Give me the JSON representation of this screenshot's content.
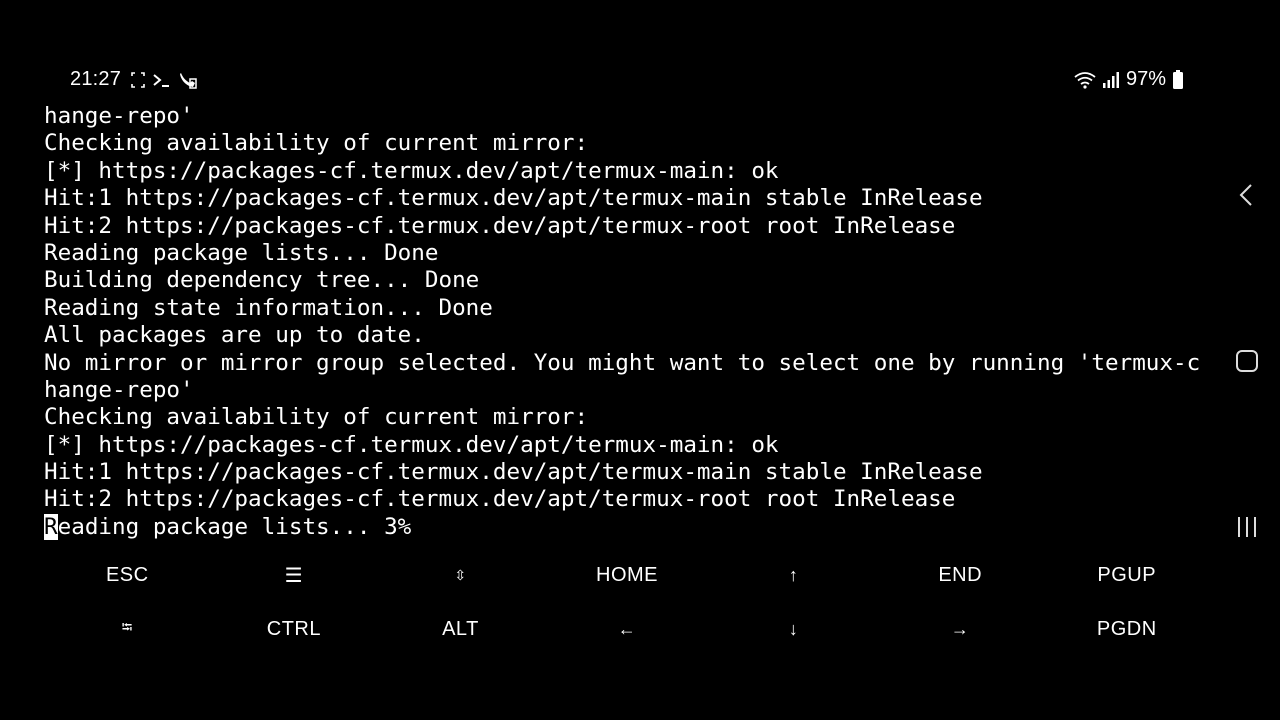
{
  "status_bar": {
    "time": "21:27",
    "battery": "97%",
    "notif_icons": [
      "screenshot-icon",
      "terminal-icon",
      "wifi-calling-icon"
    ],
    "system_icons": [
      "wifi-icon",
      "signal-icon",
      "battery-icon"
    ]
  },
  "terminal": {
    "lines": [
      "hange-repo'",
      "Checking availability of current mirror:",
      "[*] https://packages-cf.termux.dev/apt/termux-main: ok",
      "Hit:1 https://packages-cf.termux.dev/apt/termux-main stable InRelease",
      "Hit:2 https://packages-cf.termux.dev/apt/termux-root root InRelease",
      "Reading package lists... Done",
      "Building dependency tree... Done",
      "Reading state information... Done",
      "All packages are up to date.",
      "No mirror or mirror group selected. You might want to select one by running 'termux-c",
      "hange-repo'",
      "Checking availability of current mirror:",
      "[*] https://packages-cf.termux.dev/apt/termux-main: ok",
      "Hit:1 https://packages-cf.termux.dev/apt/termux-main stable InRelease",
      "Hit:2 https://packages-cf.termux.dev/apt/termux-root root InRelease"
    ],
    "cursor_char": "R",
    "last_line_rest": "eading package lists... 3%"
  },
  "extra_keys": {
    "row1": [
      "ESC",
      "☰",
      "⇳",
      "HOME",
      "↑",
      "END",
      "PGUP"
    ],
    "row2": [
      "⭾",
      "CTRL",
      "ALT",
      "←",
      "↓",
      "→",
      "PGDN"
    ]
  },
  "nav": {
    "buttons": [
      "back-icon",
      "home-icon",
      "recents-icon"
    ]
  }
}
